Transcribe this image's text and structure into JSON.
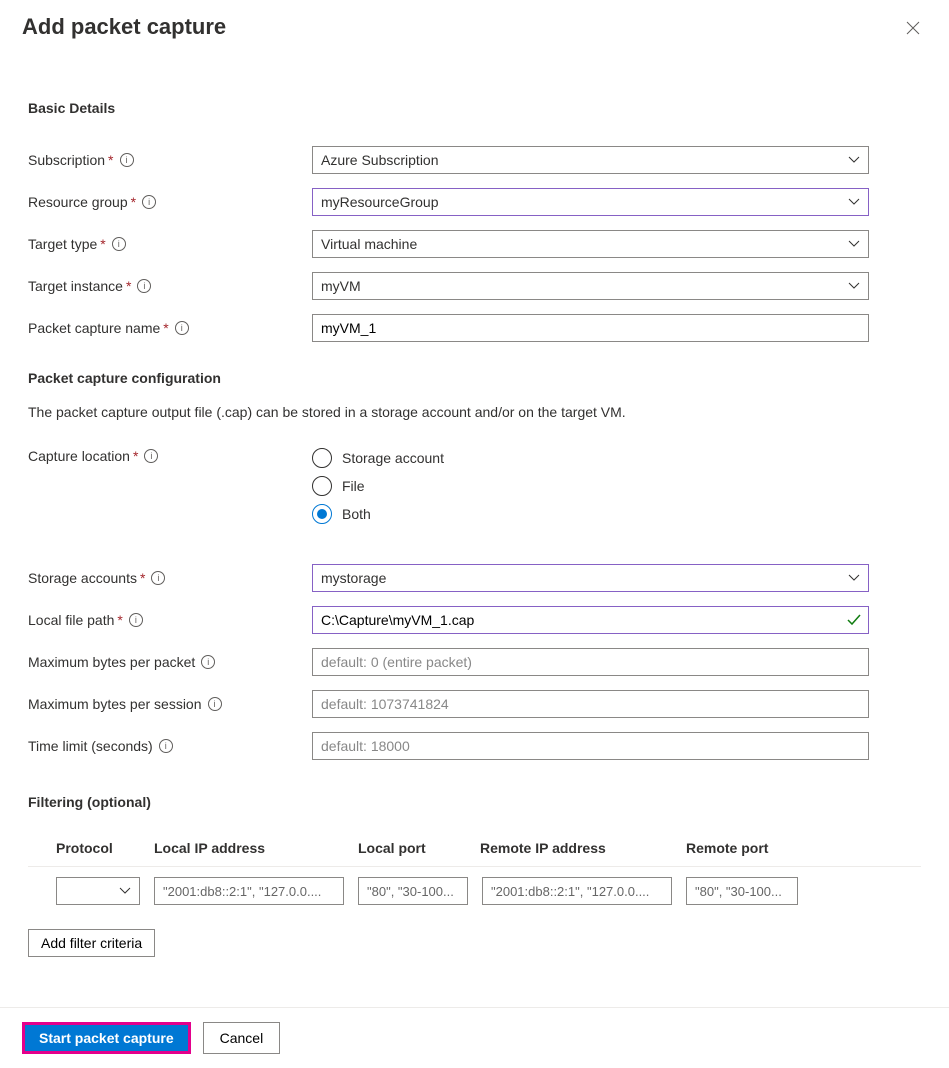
{
  "header": {
    "title": "Add packet capture"
  },
  "sections": {
    "basic": {
      "heading": "Basic Details",
      "subscription_label": "Subscription",
      "subscription_value": "Azure Subscription",
      "resource_group_label": "Resource group",
      "resource_group_value": "myResourceGroup",
      "target_type_label": "Target type",
      "target_type_value": "Virtual machine",
      "target_instance_label": "Target instance",
      "target_instance_value": "myVM",
      "capture_name_label": "Packet capture name",
      "capture_name_value": "myVM_1"
    },
    "config": {
      "heading": "Packet capture configuration",
      "description": "The packet capture output file (.cap) can be stored in a storage account and/or on the target VM.",
      "capture_location_label": "Capture location",
      "capture_location_options": {
        "storage": "Storage account",
        "file": "File",
        "both": "Both"
      },
      "capture_location_selected": "both",
      "storage_accounts_label": "Storage accounts",
      "storage_accounts_value": "mystorage",
      "local_file_path_label": "Local file path",
      "local_file_path_value": "C:\\Capture\\myVM_1.cap",
      "max_bytes_packet_label": "Maximum bytes per packet",
      "max_bytes_packet_placeholder": "default: 0 (entire packet)",
      "max_bytes_session_label": "Maximum bytes per session",
      "max_bytes_session_placeholder": "default: 1073741824",
      "time_limit_label": "Time limit (seconds)",
      "time_limit_placeholder": "default: 18000"
    },
    "filtering": {
      "heading": "Filtering (optional)",
      "columns": {
        "protocol": "Protocol",
        "local_ip": "Local IP address",
        "local_port": "Local port",
        "remote_ip": "Remote IP address",
        "remote_port": "Remote port"
      },
      "placeholders": {
        "local_ip": "\"2001:db8::2:1\", \"127.0.0....",
        "local_port": "\"80\", \"30-100...",
        "remote_ip": "\"2001:db8::2:1\", \"127.0.0....",
        "remote_port": "\"80\", \"30-100..."
      },
      "add_filter_label": "Add filter criteria"
    }
  },
  "footer": {
    "primary": "Start packet capture",
    "secondary": "Cancel"
  }
}
